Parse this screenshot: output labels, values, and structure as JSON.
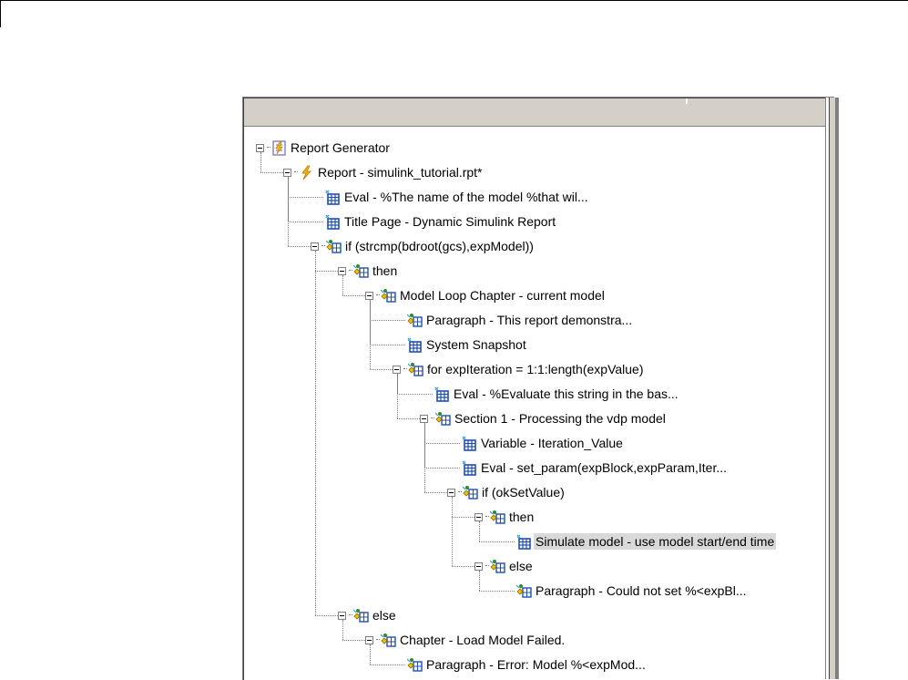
{
  "tree": [
    {
      "label": "Report Generator",
      "icon": "report-generator-icon",
      "depth": 0,
      "expanded": true
    },
    {
      "label": "Report - simulink_tutorial.rpt*",
      "icon": "lightning-report-icon",
      "depth": 1,
      "expanded": true
    },
    {
      "label": "Eval - %The name of the model %that wil...",
      "icon": "grid-component-icon",
      "depth": 2
    },
    {
      "label": "Title Page - Dynamic Simulink Report",
      "icon": "grid-component-icon",
      "depth": 2
    },
    {
      "label": "if (strcmp(bdroot(gcs),expModel))",
      "icon": "logic-component-icon",
      "depth": 2,
      "expanded": true
    },
    {
      "label": "then",
      "icon": "logic-component-icon",
      "depth": 3,
      "expanded": true
    },
    {
      "label": "Model Loop Chapter - current model",
      "icon": "logic-component-icon",
      "depth": 4,
      "expanded": true
    },
    {
      "label": "Paragraph - This report demonstra...",
      "icon": "logic-component-icon",
      "depth": 5
    },
    {
      "label": "System Snapshot",
      "icon": "grid-component-icon",
      "depth": 5
    },
    {
      "label": "for expIteration = 1:1:length(expValue)",
      "icon": "logic-component-icon",
      "depth": 5,
      "expanded": true
    },
    {
      "label": "Eval - %Evaluate this string in the bas...",
      "icon": "grid-component-icon",
      "depth": 6
    },
    {
      "label": "Section 1 - Processing the vdp model",
      "icon": "logic-component-icon",
      "depth": 6,
      "expanded": true
    },
    {
      "label": "Variable - Iteration_Value",
      "icon": "grid-component-icon",
      "depth": 7
    },
    {
      "label": "Eval - set_param(expBlock,expParam,Iter...",
      "icon": "grid-component-icon",
      "depth": 7
    },
    {
      "label": "if (okSetValue)",
      "icon": "logic-component-icon",
      "depth": 7,
      "expanded": true
    },
    {
      "label": "then",
      "icon": "logic-component-icon",
      "depth": 8,
      "expanded": true
    },
    {
      "label": "Simulate model - use model start/end time",
      "icon": "grid-component-icon",
      "depth": 9,
      "selected": true
    },
    {
      "label": "else",
      "icon": "logic-component-icon",
      "depth": 8,
      "expanded": true
    },
    {
      "label": "Paragraph - Could not set %<expBl...",
      "icon": "logic-component-icon",
      "depth": 9
    },
    {
      "label": "else",
      "icon": "logic-component-icon",
      "depth": 3,
      "expanded": true
    },
    {
      "label": "Chapter - Load Model Failed.",
      "icon": "logic-component-icon",
      "depth": 4,
      "expanded": true
    },
    {
      "label": "Paragraph - Error: Model %<expMod...",
      "icon": "logic-component-icon",
      "depth": 5
    }
  ],
  "colors": {
    "selection": "#d9d9d9",
    "header": "#d4d0c8",
    "grid_icon": "#1f4fb4",
    "logic_icon": "#2f8a2f",
    "lightning": "#f5b800"
  }
}
